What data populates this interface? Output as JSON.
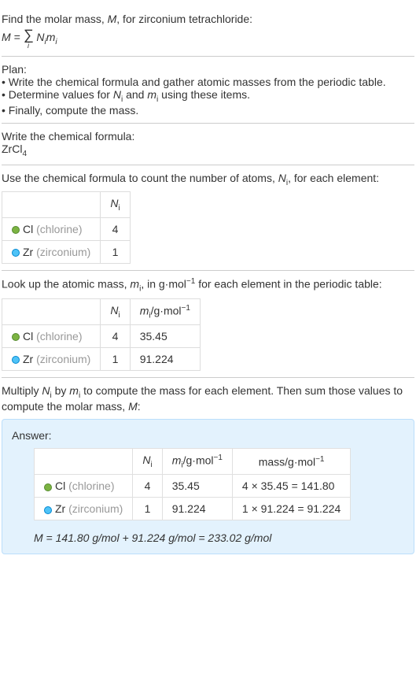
{
  "intro": {
    "line1": "Find the molar mass, ",
    "line1_var": "M",
    "line1_end": ", for zirconium tetrachloride:",
    "formula_lhs": "M = ",
    "formula_sigma": "∑",
    "formula_sigma_sub": "i",
    "formula_rhs": " N",
    "formula_rhs_sub1": "i",
    "formula_rhs2": "m",
    "formula_rhs_sub2": "i"
  },
  "plan": {
    "title": "Plan:",
    "b1": "• Write the chemical formula and gather atomic masses from the periodic table.",
    "b2_a": "• Determine values for ",
    "b2_n": "N",
    "b2_ni": "i",
    "b2_b": " and ",
    "b2_m": "m",
    "b2_mi": "i",
    "b2_c": " using these items.",
    "b3": "• Finally, compute the mass."
  },
  "chemformula": {
    "title": "Write the chemical formula:",
    "val": "ZrCl",
    "sub": "4"
  },
  "count": {
    "title_a": "Use the chemical formula to count the number of atoms, ",
    "title_n": "N",
    "title_ni": "i",
    "title_b": ", for each element:",
    "header_n": "N",
    "header_ni": "i",
    "rows": [
      {
        "symbol": "Cl",
        "name": "(chlorine)",
        "n": "4",
        "color": "green"
      },
      {
        "symbol": "Zr",
        "name": "(zirconium)",
        "n": "1",
        "color": "blue"
      }
    ]
  },
  "mass": {
    "title_a": "Look up the atomic mass, ",
    "title_m": "m",
    "title_mi": "i",
    "title_b": ", in g·mol",
    "title_sup": "−1",
    "title_c": " for each element in the periodic table:",
    "header_n": "N",
    "header_ni": "i",
    "header_m": "m",
    "header_mi": "i",
    "header_unit": "/g·mol",
    "header_sup": "−1",
    "rows": [
      {
        "symbol": "Cl",
        "name": "(chlorine)",
        "n": "4",
        "m": "35.45",
        "color": "green"
      },
      {
        "symbol": "Zr",
        "name": "(zirconium)",
        "n": "1",
        "m": "91.224",
        "color": "blue"
      }
    ]
  },
  "multiply": {
    "text_a": "Multiply ",
    "text_n": "N",
    "text_ni": "i",
    "text_b": " by ",
    "text_m": "m",
    "text_mi": "i",
    "text_c": " to compute the mass for each element. Then sum those values to compute the molar mass, ",
    "text_M": "M",
    "text_d": ":"
  },
  "answer": {
    "label": "Answer:",
    "header_n": "N",
    "header_ni": "i",
    "header_m": "m",
    "header_mi": "i",
    "header_unit": "/g·mol",
    "header_sup": "−1",
    "header_mass": "mass/g·mol",
    "header_mass_sup": "−1",
    "rows": [
      {
        "symbol": "Cl",
        "name": "(chlorine)",
        "n": "4",
        "m": "35.45",
        "calc": "4 × 35.45 = 141.80",
        "color": "green"
      },
      {
        "symbol": "Zr",
        "name": "(zirconium)",
        "n": "1",
        "m": "91.224",
        "calc": "1 × 91.224 = 91.224",
        "color": "blue"
      }
    ],
    "final": "M = 141.80 g/mol + 91.224 g/mol = 233.02 g/mol"
  },
  "chart_data": {
    "type": "table",
    "title": "Molar mass calculation for zirconium tetrachloride (ZrCl4)",
    "rows": [
      {
        "element": "Cl",
        "name": "chlorine",
        "N_i": 4,
        "m_i_g_per_mol": 35.45,
        "mass_g_per_mol": 141.8
      },
      {
        "element": "Zr",
        "name": "zirconium",
        "N_i": 1,
        "m_i_g_per_mol": 91.224,
        "mass_g_per_mol": 91.224
      }
    ],
    "molar_mass_g_per_mol": 233.02
  }
}
